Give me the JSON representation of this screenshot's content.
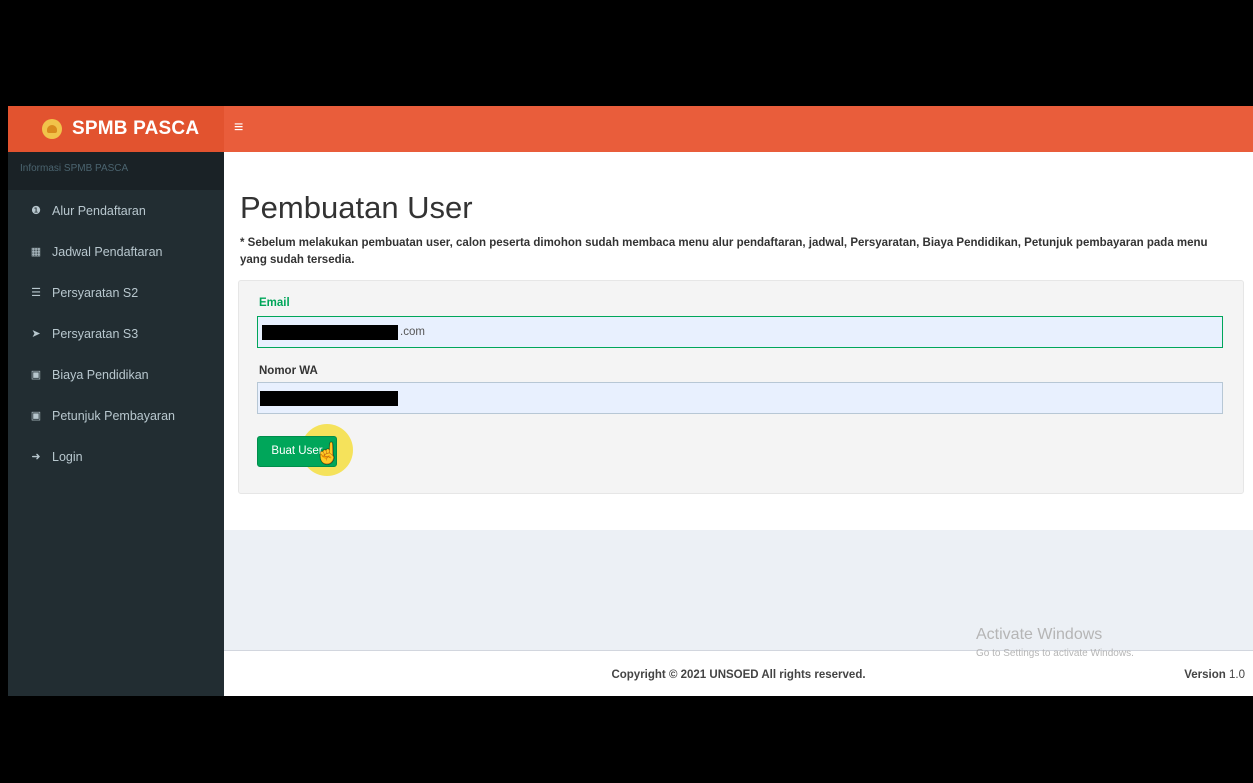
{
  "brand": {
    "name": "SPMB PASCA",
    "menu_icon": "≡"
  },
  "sidebar": {
    "header": "Informasi SPMB PASCA",
    "items": [
      {
        "icon": "❶",
        "icon_name": "info-circle-icon",
        "label": "Alur Pendaftaran"
      },
      {
        "icon": "▦",
        "icon_name": "calendar-icon",
        "label": "Jadwal Pendaftaran"
      },
      {
        "icon": "☰",
        "icon_name": "list-icon",
        "label": "Persyaratan S2"
      },
      {
        "icon": "➤",
        "icon_name": "rocket-icon",
        "label": "Persyaratan S3"
      },
      {
        "icon": "▣",
        "icon_name": "money-icon",
        "label": "Biaya Pendidikan"
      },
      {
        "icon": "▣",
        "icon_name": "money-icon",
        "label": "Petunjuk Pembayaran"
      },
      {
        "icon": "➜",
        "icon_name": "sign-in-icon",
        "label": "Login"
      }
    ]
  },
  "main": {
    "title": "Pembuatan User",
    "notice": "* Sebelum melakukan pembuatan user, calon peserta dimohon sudah membaca menu alur pendaftaran, jadwal, Persyaratan, Biaya Pendidikan, Petunjuk pembayaran pada menu yang sudah tersedia.",
    "form": {
      "email_label": "Email",
      "email_value_visible": ".com",
      "wa_label": "Nomor WA",
      "submit_label": "Buat User"
    }
  },
  "footer": {
    "copyright": "Copyright © 2021 UNSOED All rights reserved.",
    "version_label": "Version",
    "version_number": "1.0"
  },
  "watermark": {
    "title": "Activate Windows",
    "subtitle": "Go to Settings to activate Windows."
  },
  "colors": {
    "topbar": "#e95d3b",
    "sidebar": "#222d32",
    "success": "#00a65a"
  }
}
